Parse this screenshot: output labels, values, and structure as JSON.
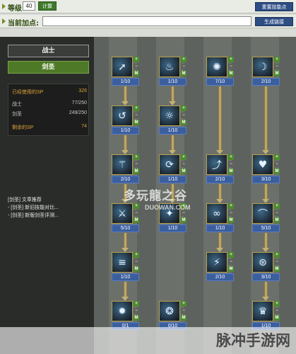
{
  "top": {
    "level_label": "等级",
    "level_value": "40",
    "calc_label": "计算",
    "reset_label": "重置技能点",
    "points_label": "当前加点:",
    "points_value": "",
    "generate_label": "生成链接"
  },
  "left": {
    "class_name": "战士",
    "subclass_name": "剑圣",
    "sp_used_label": "已经使用的SP",
    "sp_used_value": "326",
    "warrior_label": "战士",
    "warrior_value": "77/250",
    "sword_label": "剑圣",
    "sword_value": "249/250",
    "sp_remain_label": "剩余的SP",
    "sp_remain_value": "74",
    "recommend_title": "[剑圣] 文章推荐",
    "recommend_items": [
      "- [剑圣] 新旧技能对比...",
      "- [剑圣] 新版剑圣评测..."
    ]
  },
  "skills": [
    {
      "level": "1/10",
      "icon": "spiral-slash-icon",
      "glyph": "➚"
    },
    {
      "level": "1/10",
      "icon": "fire-crown-icon",
      "glyph": "♨"
    },
    {
      "level": "7/10",
      "icon": "flame-icon",
      "glyph": "✺"
    },
    {
      "level": "2/10",
      "icon": "crescent-icon",
      "glyph": "☽"
    },
    {
      "level": "1/10",
      "icon": "whirl-icon",
      "glyph": "↺"
    },
    {
      "level": "1/10",
      "icon": "aura-icon",
      "glyph": "☼"
    },
    {
      "level": "2/10",
      "icon": "trident-icon",
      "glyph": "⚚"
    },
    {
      "level": "1/10",
      "icon": "sweep-icon",
      "glyph": "⟳"
    },
    {
      "level": "2/10",
      "icon": "arc-slash-icon",
      "glyph": "⤴"
    },
    {
      "level": "3/10",
      "icon": "wing-icon",
      "glyph": "♥"
    },
    {
      "level": "5/10",
      "icon": "cleave-icon",
      "glyph": "⚔"
    },
    {
      "level": "1/10",
      "icon": "dash-icon",
      "glyph": "✦"
    },
    {
      "level": "1/10",
      "icon": "swirl-icon",
      "glyph": "∞"
    },
    {
      "level": "5/10",
      "icon": "blade-arc-icon",
      "glyph": "⌒"
    },
    {
      "level": "1/10",
      "icon": "triple-slash-icon",
      "glyph": "≡"
    },
    {
      "level": "2/10",
      "icon": "flash-icon",
      "glyph": "⚡"
    },
    {
      "level": "3/10",
      "icon": "cyclone-icon",
      "glyph": "⊛"
    },
    {
      "level": "0/1",
      "icon": "ultimate-icon",
      "glyph": "✹"
    },
    {
      "level": "0/10",
      "icon": "glyph-sigil-icon",
      "glyph": "❂"
    },
    {
      "level": "1/10",
      "icon": "crystal-icon",
      "glyph": "♛"
    }
  ],
  "watermarks": {
    "center_main": "多玩龍之谷",
    "center_sub": "DUOWAN.COM",
    "corner_text": "脉冲手游网"
  }
}
